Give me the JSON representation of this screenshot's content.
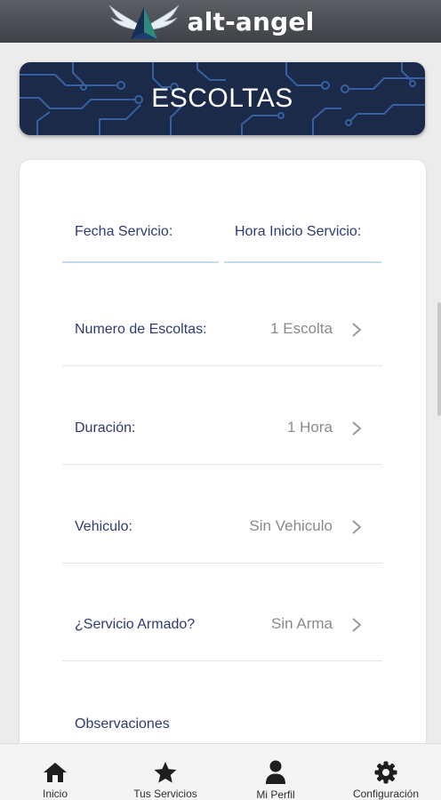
{
  "header": {
    "logo_text": "alt-angel"
  },
  "banner": {
    "title": "ESCOLTAS"
  },
  "form": {
    "date_field": {
      "label": "Fecha Servicio:"
    },
    "time_field": {
      "label": "Hora Inicio Servicio:"
    },
    "options": [
      {
        "label": "Numero de Escoltas:",
        "value": "1 Escolta"
      },
      {
        "label": "Duración:",
        "value": "1 Hora"
      },
      {
        "label": "Vehiculo:",
        "value": "Sin Vehiculo"
      },
      {
        "label": "¿Servicio Armado?",
        "value": "Sin Arma"
      }
    ],
    "observations_label": "Observaciones"
  },
  "bottom_nav": {
    "items": [
      {
        "label": "Inicio",
        "icon": "home-icon"
      },
      {
        "label": "Tus Servicios",
        "icon": "star-icon"
      },
      {
        "label": "Mi Perfil",
        "icon": "user-icon"
      },
      {
        "label": "Configuración",
        "icon": "gear-icon"
      }
    ]
  },
  "colors": {
    "label_text": "#2f3b72",
    "value_text": "#8a8a8a",
    "banner_bg": "#1b2a48",
    "field_underline": "#c4dde8"
  }
}
